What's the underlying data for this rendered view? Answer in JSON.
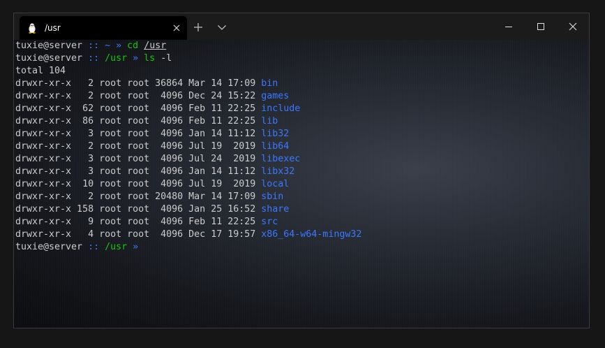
{
  "tab": {
    "title": "/usr",
    "icon": "linux-penguin-icon"
  },
  "titlebar": {
    "new_tab_icon": "plus-icon",
    "dropdown_icon": "chevron-down-icon",
    "minimize_icon": "minimize-icon",
    "maximize_icon": "maximize-icon",
    "close_icon": "close-icon"
  },
  "prompt": {
    "user_host": "tuxie@server",
    "separator": " :: ",
    "arrow": " » "
  },
  "commands": [
    {
      "cwd": "~",
      "cmd": "cd",
      "arg": "/usr"
    },
    {
      "cwd": "/usr",
      "cmd": "ls",
      "arg": "-l"
    },
    {
      "cwd": "/usr",
      "cmd": "",
      "arg": ""
    }
  ],
  "output": {
    "total": "total 104",
    "rows": [
      {
        "meta": "drwxr-xr-x   2 root root 36864 Mar 14 17:09 ",
        "name": "bin"
      },
      {
        "meta": "drwxr-xr-x   2 root root  4096 Dec 24 15:22 ",
        "name": "games"
      },
      {
        "meta": "drwxr-xr-x  62 root root  4096 Feb 11 22:25 ",
        "name": "include"
      },
      {
        "meta": "drwxr-xr-x  86 root root  4096 Feb 11 22:25 ",
        "name": "lib"
      },
      {
        "meta": "drwxr-xr-x   3 root root  4096 Jan 14 11:12 ",
        "name": "lib32"
      },
      {
        "meta": "drwxr-xr-x   2 root root  4096 Jul 19  2019 ",
        "name": "lib64"
      },
      {
        "meta": "drwxr-xr-x   3 root root  4096 Jul 24  2019 ",
        "name": "libexec"
      },
      {
        "meta": "drwxr-xr-x   3 root root  4096 Jan 14 11:12 ",
        "name": "libx32"
      },
      {
        "meta": "drwxr-xr-x  10 root root  4096 Jul 19  2019 ",
        "name": "local"
      },
      {
        "meta": "drwxr-xr-x   2 root root 20480 Mar 14 17:09 ",
        "name": "sbin"
      },
      {
        "meta": "drwxr-xr-x 158 root root  4096 Jan 25 16:52 ",
        "name": "share"
      },
      {
        "meta": "drwxr-xr-x   9 root root  4096 Feb 11 22:25 ",
        "name": "src"
      },
      {
        "meta": "drwxr-xr-x   4 root root  4096 Dec 17 19:57 ",
        "name": "x86_64-w64-mingw32"
      }
    ]
  },
  "colors": {
    "directory": "#3b78ff",
    "command": "#16c60c",
    "text": "#cccccc",
    "titlebar": "#1b1b1b"
  }
}
